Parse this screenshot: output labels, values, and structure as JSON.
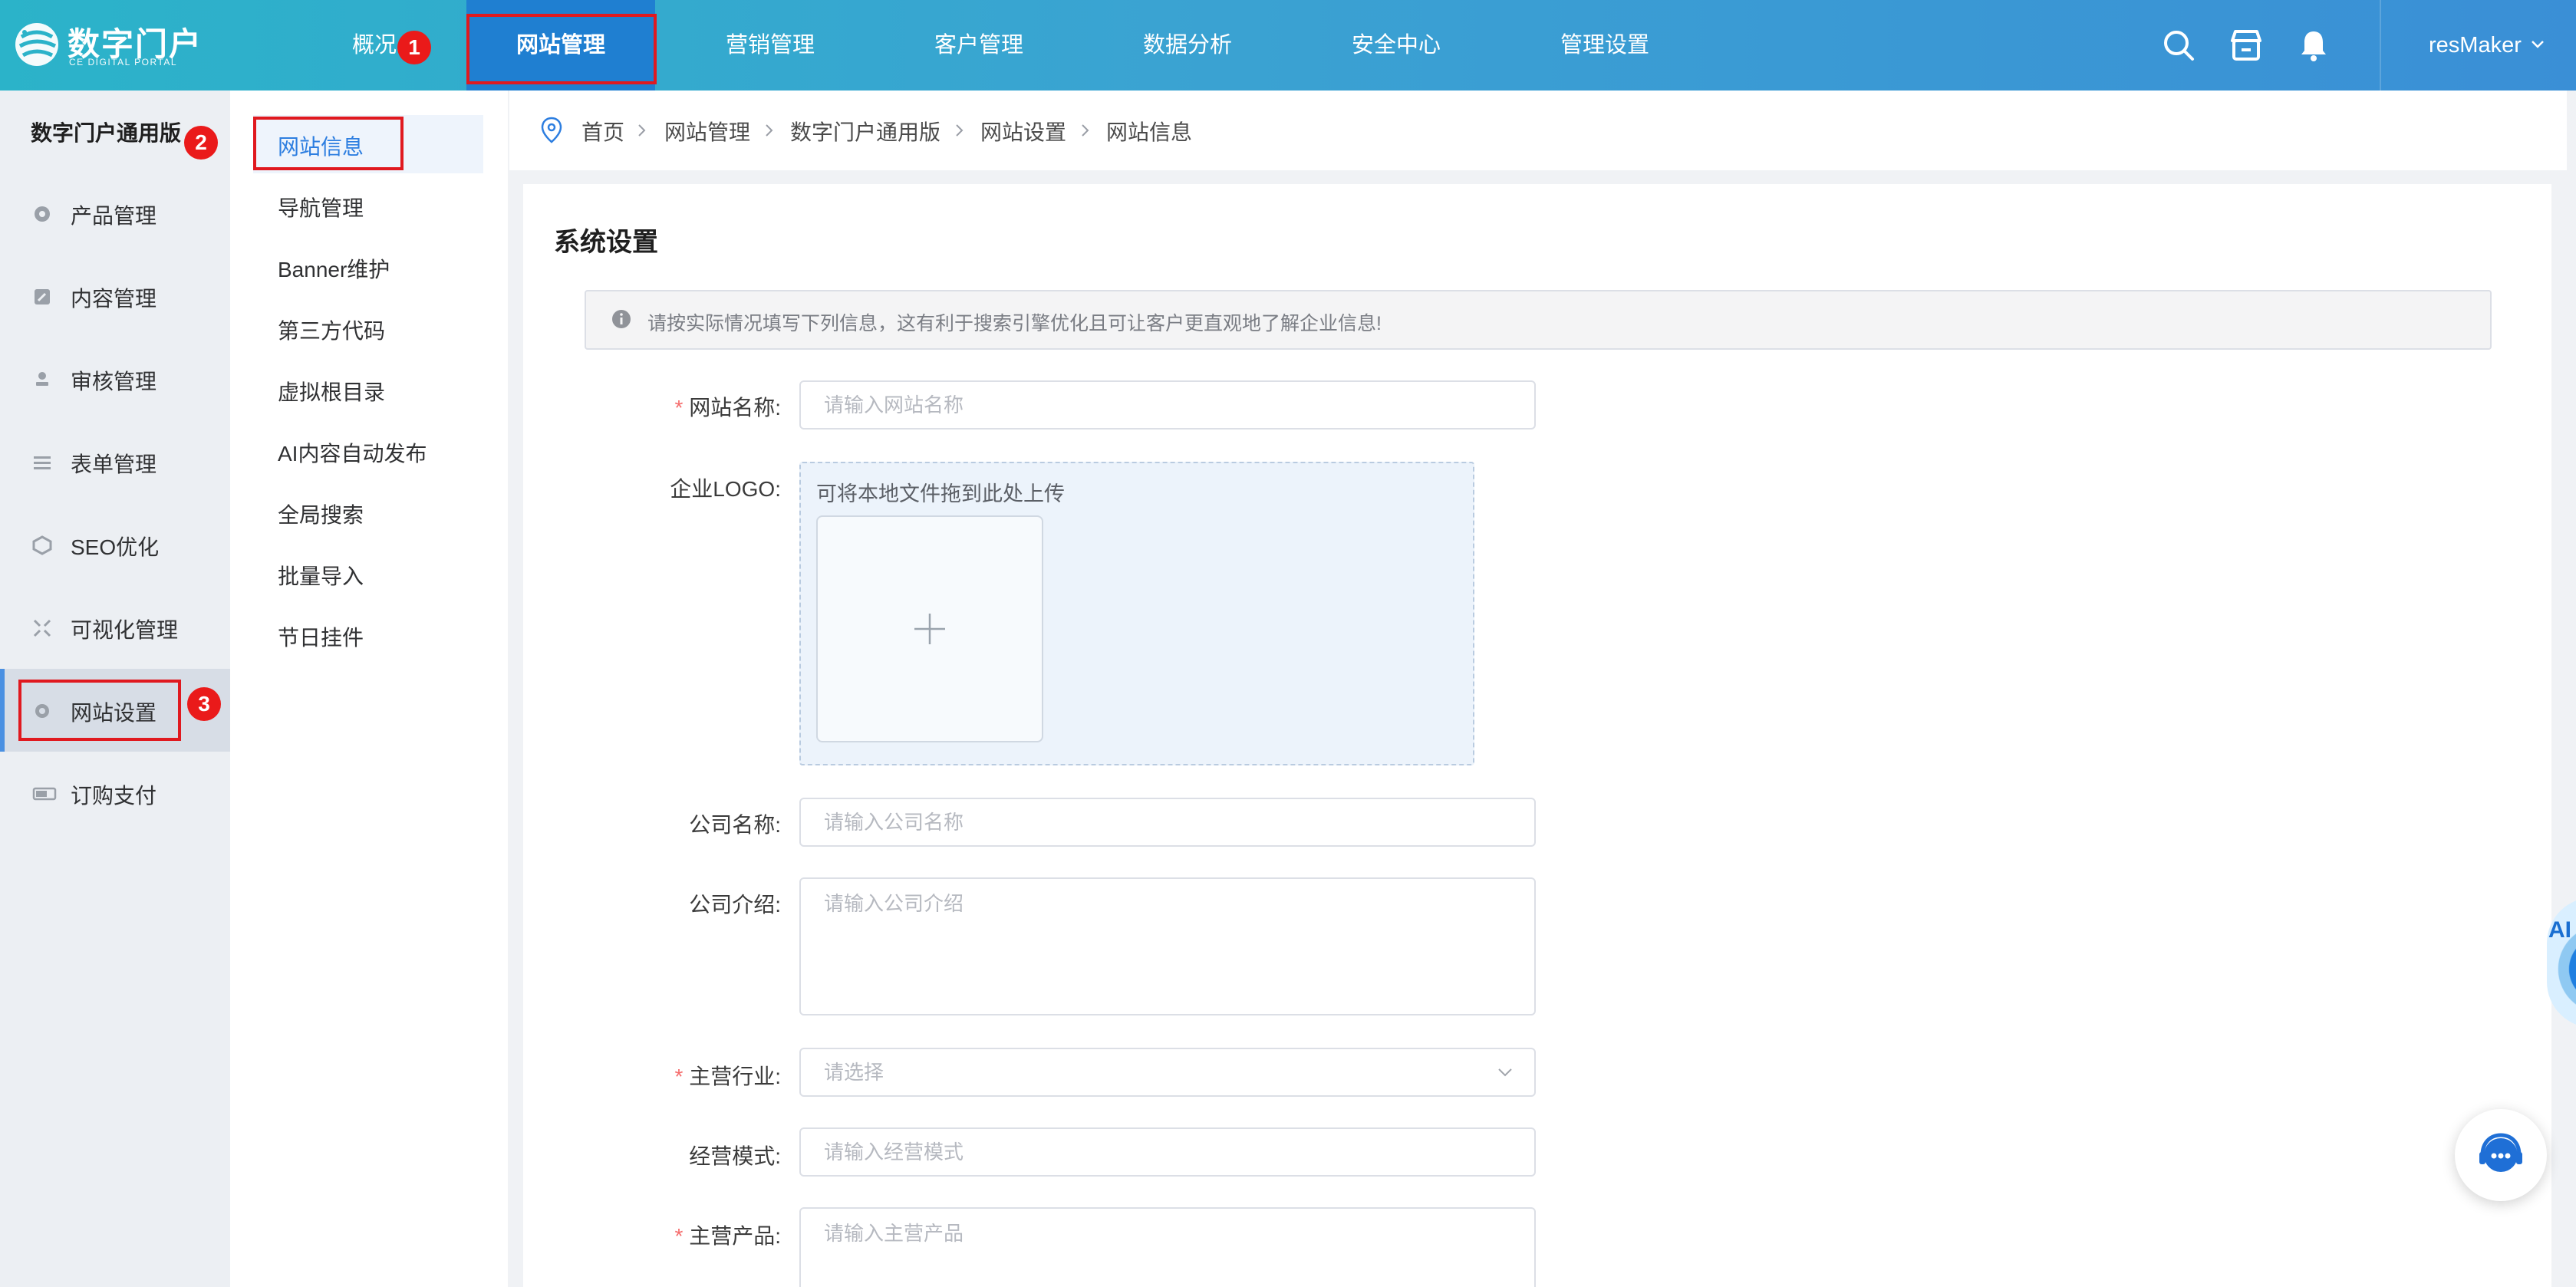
{
  "brand": {
    "title": "数字门户",
    "subtitle": "CE DIGITAL PORTAL"
  },
  "topnav": {
    "items": [
      {
        "label": "概况"
      },
      {
        "label": "网站管理"
      },
      {
        "label": "营销管理"
      },
      {
        "label": "客户管理"
      },
      {
        "label": "数据分析"
      },
      {
        "label": "安全中心"
      },
      {
        "label": "管理设置"
      }
    ],
    "active": "网站管理",
    "icons": [
      "search-icon",
      "store-icon",
      "bell-icon"
    ],
    "user": "resMaker"
  },
  "sidebar": {
    "title": "数字门户通用版",
    "items": [
      {
        "label": "产品管理",
        "icon": "circle-gear-icon"
      },
      {
        "label": "内容管理",
        "icon": "edit-icon"
      },
      {
        "label": "审核管理",
        "icon": "stamp-icon"
      },
      {
        "label": "表单管理",
        "icon": "list-icon"
      },
      {
        "label": "SEO优化",
        "icon": "cube-icon"
      },
      {
        "label": "可视化管理",
        "icon": "expand-icon"
      },
      {
        "label": "网站设置",
        "icon": "gear-icon"
      },
      {
        "label": "订购支付",
        "icon": "battery-icon"
      }
    ],
    "active": "网站设置"
  },
  "subnav": {
    "items": [
      {
        "label": "网站信息"
      },
      {
        "label": "导航管理"
      },
      {
        "label": "Banner维护"
      },
      {
        "label": "第三方代码"
      },
      {
        "label": "虚拟根目录"
      },
      {
        "label": "AI内容自动发布"
      },
      {
        "label": "全局搜索"
      },
      {
        "label": "批量导入"
      },
      {
        "label": "节日挂件"
      }
    ],
    "active": "网站信息"
  },
  "breadcrumb": [
    "首页",
    "网站管理",
    "数字门户通用版",
    "网站设置",
    "网站信息"
  ],
  "page": {
    "title": "系统设置",
    "notice": "请按实际情况填写下列信息，这有利于搜索引擎优化且可让客户更直观地了解企业信息!"
  },
  "form": {
    "site_name": {
      "label": "网站名称:",
      "required": "*",
      "placeholder": "请输入网站名称"
    },
    "logo": {
      "label": "企业LOGO:",
      "hint": "可将本地文件拖到此处上传"
    },
    "company_name": {
      "label": "公司名称:",
      "placeholder": "请输入公司名称"
    },
    "company_intro": {
      "label": "公司介绍:",
      "placeholder": "请输入公司介绍"
    },
    "industry": {
      "label": "主营行业:",
      "required": "*",
      "placeholder": "请选择"
    },
    "business_mode": {
      "label": "经营模式:",
      "placeholder": "请输入经营模式"
    },
    "products": {
      "label": "主营产品:",
      "required": "*",
      "placeholder": "请输入主营产品"
    }
  },
  "annotations": {
    "badges": [
      "1",
      "2",
      "3"
    ],
    "color": "#e0191f"
  },
  "float": {
    "ai_label": "AI"
  },
  "colors": {
    "topbar_start": "#2bb3c9",
    "topbar_end": "#3a8fd6",
    "active_nav": "#1f7fd1",
    "link_active": "#2d7ee0",
    "required": "#f56c6c"
  }
}
